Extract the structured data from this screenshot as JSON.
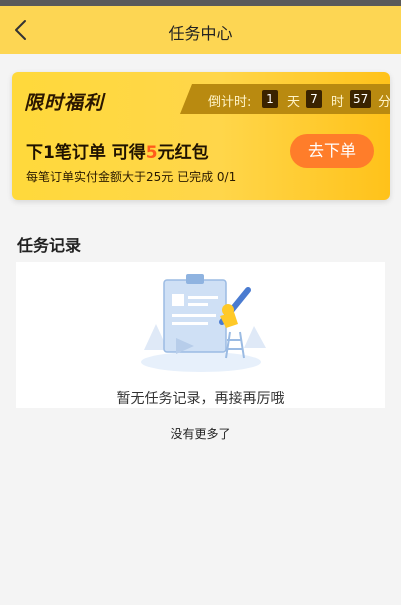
{
  "header": {
    "title": "任务中心",
    "back_icon": "chevron-left-icon"
  },
  "promo": {
    "title": "限时福利",
    "countdown": {
      "label": "倒计时:",
      "days": "1",
      "day_unit": "天",
      "hours": "7",
      "hour_unit": "时",
      "minutes": "57",
      "minute_unit": "分"
    },
    "main_pre": "下1笔订单 可得",
    "main_amount": "5",
    "main_post": "元红包",
    "sub_text": "每笔订单实付金额大于25元 已完成 0/1",
    "button_label": "去下单"
  },
  "records": {
    "title": "任务记录",
    "empty_text": "暂无任务记录，再接再厉哦",
    "empty_illustration": "clipboard-with-pencil-illustration"
  },
  "footer": {
    "no_more_text": "没有更多了"
  },
  "colors": {
    "nav_bg": "#fdd653",
    "accent_orange": "#ff7d2a",
    "highlight": "#ff5b1a"
  }
}
